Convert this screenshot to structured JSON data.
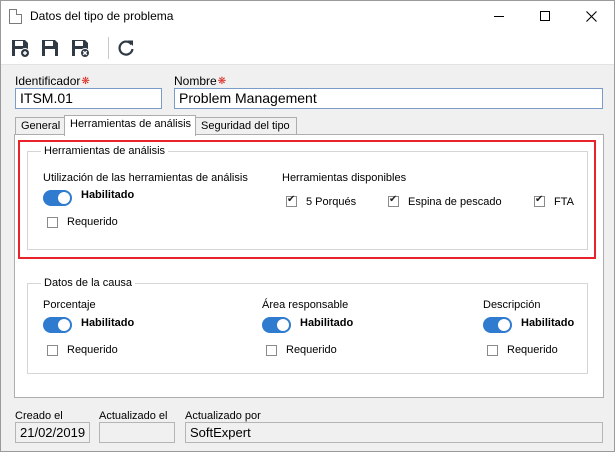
{
  "window": {
    "title": "Datos del tipo de problema"
  },
  "toolbar": {
    "save_new_icon": "save-plus-icon",
    "save_icon": "save-icon",
    "save_close_icon": "save-close-icon",
    "refresh_icon": "refresh-icon"
  },
  "header": {
    "id_label": "Identificador",
    "id_value": "ITSM.01",
    "name_label": "Nombre",
    "name_value": "Problem Management",
    "required_mark": "❋"
  },
  "tabs": [
    {
      "label": "General"
    },
    {
      "label": "Herramientas de análisis"
    },
    {
      "label": "Seguridad del tipo"
    }
  ],
  "analysis_group": {
    "title": "Herramientas de análisis",
    "usage_label": "Utilización de las herramientas de análisis",
    "enabled_label": "Habilitado",
    "required_label": "Requerido",
    "available_label": "Herramientas disponibles",
    "tools": [
      {
        "label": "5 Porqués",
        "checked": true
      },
      {
        "label": "Espina de pescado",
        "checked": true
      },
      {
        "label": "FTA",
        "checked": true
      }
    ]
  },
  "cause_group": {
    "title": "Datos de la causa",
    "columns": [
      {
        "label": "Porcentaje",
        "enabled_label": "Habilitado",
        "required_label": "Requerido"
      },
      {
        "label": "Área responsable",
        "enabled_label": "Habilitado",
        "required_label": "Requerido"
      },
      {
        "label": "Descripción",
        "enabled_label": "Habilitado",
        "required_label": "Requerido"
      }
    ]
  },
  "footer": {
    "created_label": "Creado el",
    "created_value": "21/02/2019",
    "updated_label": "Actualizado el",
    "updated_value": "",
    "updated_by_label": "Actualizado por",
    "updated_by_value": "SoftExpert"
  },
  "colors": {
    "accent": "#2e7bcf",
    "highlight": "#e8232c",
    "required": "#d9261c"
  }
}
